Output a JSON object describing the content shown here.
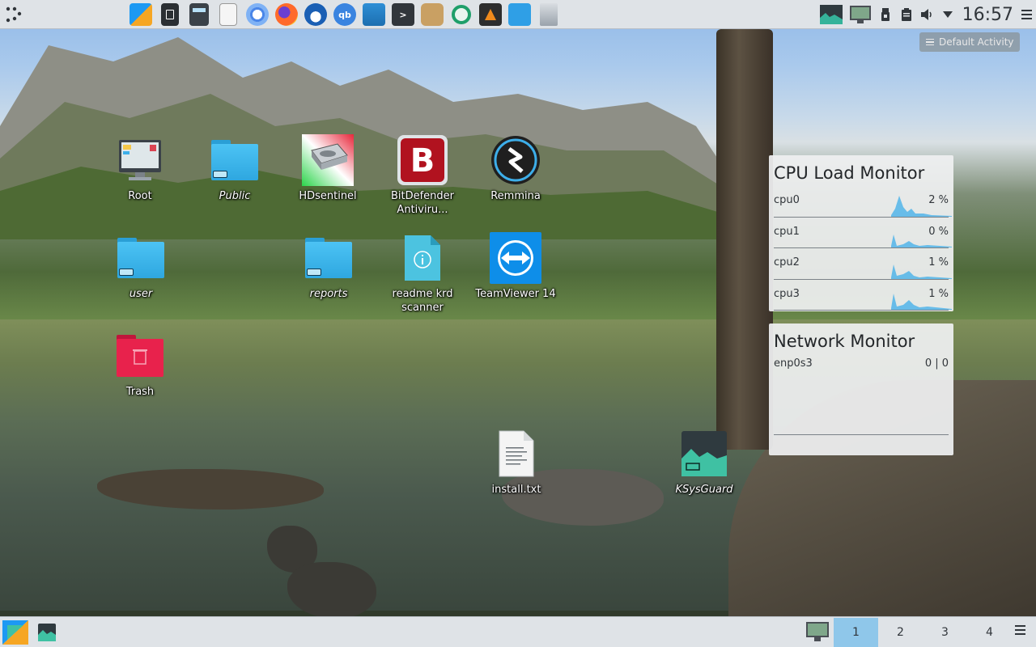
{
  "top_panel": {
    "launchers": [
      {
        "name": "kde-logo-launcher",
        "icon": "kde-icon"
      },
      {
        "name": "notes-launcher",
        "icon": "notes-icon"
      },
      {
        "name": "calculator-launcher",
        "icon": "calculator-icon"
      },
      {
        "name": "text-editor-launcher",
        "icon": "document-icon"
      },
      {
        "name": "chromium-launcher",
        "icon": "chromium-icon"
      },
      {
        "name": "firefox-launcher",
        "icon": "firefox-icon"
      },
      {
        "name": "thunderbird-launcher",
        "icon": "thunderbird-icon"
      },
      {
        "name": "qbittorrent-launcher",
        "icon": "qbittorrent-icon"
      },
      {
        "name": "file-manager-launcher",
        "icon": "folder-icon"
      },
      {
        "name": "terminal-launcher",
        "icon": "terminal-icon"
      },
      {
        "name": "gimp-launcher",
        "icon": "gimp-icon"
      },
      {
        "name": "app-launcher",
        "icon": "ring-icon"
      },
      {
        "name": "vlc-launcher",
        "icon": "vlc-icon"
      },
      {
        "name": "remote-desktop-launcher",
        "icon": "remote-icon"
      },
      {
        "name": "package-launcher",
        "icon": "package-icon"
      }
    ],
    "clock": "16:57",
    "qbittorrent_label": "qb"
  },
  "activity": {
    "label": "Default Activity"
  },
  "desktop_icons": [
    {
      "id": "root",
      "label": "Root",
      "italic": false,
      "kind": "computer"
    },
    {
      "id": "public",
      "label": "Public",
      "italic": true,
      "kind": "folder-link"
    },
    {
      "id": "hdsentinel",
      "label": "HDsentinel",
      "italic": false,
      "kind": "hdsentinel"
    },
    {
      "id": "bitdefender",
      "label": "BitDefender Antiviru...",
      "italic": false,
      "kind": "bitdefender"
    },
    {
      "id": "remmina",
      "label": "Remmina",
      "italic": false,
      "kind": "remmina"
    },
    {
      "id": "user",
      "label": "user",
      "italic": true,
      "kind": "folder-link"
    },
    {
      "id": "reports",
      "label": "reports",
      "italic": true,
      "kind": "folder-link"
    },
    {
      "id": "readme",
      "label": "readme krd scanner",
      "italic": false,
      "kind": "info-file"
    },
    {
      "id": "teamviewer",
      "label": "TeamViewer 14",
      "italic": false,
      "kind": "teamviewer"
    },
    {
      "id": "trash",
      "label": "Trash",
      "italic": false,
      "kind": "trash"
    },
    {
      "id": "install",
      "label": "install.txt",
      "italic": false,
      "kind": "text-file"
    },
    {
      "id": "ksysguard",
      "label": "KSysGuard",
      "italic": true,
      "kind": "ksysguard"
    }
  ],
  "cpu_widget": {
    "title": "CPU Load Monitor",
    "rows": [
      {
        "name": "cpu0",
        "value": "2 %"
      },
      {
        "name": "cpu1",
        "value": "0 %"
      },
      {
        "name": "cpu2",
        "value": "1 %"
      },
      {
        "name": "cpu3",
        "value": "1 %"
      }
    ]
  },
  "network_widget": {
    "title": "Network Monitor",
    "rows": [
      {
        "name": "enp0s3",
        "value": "0 | 0"
      }
    ]
  },
  "bottom_panel": {
    "desktops": [
      "1",
      "2",
      "3",
      "4"
    ],
    "active_desktop": "1"
  },
  "colors": {
    "panel": "#dfe3e7",
    "pager_active": "#8fc7ea",
    "folder": "#3db4ea",
    "graph_fill": "#3daee9"
  }
}
